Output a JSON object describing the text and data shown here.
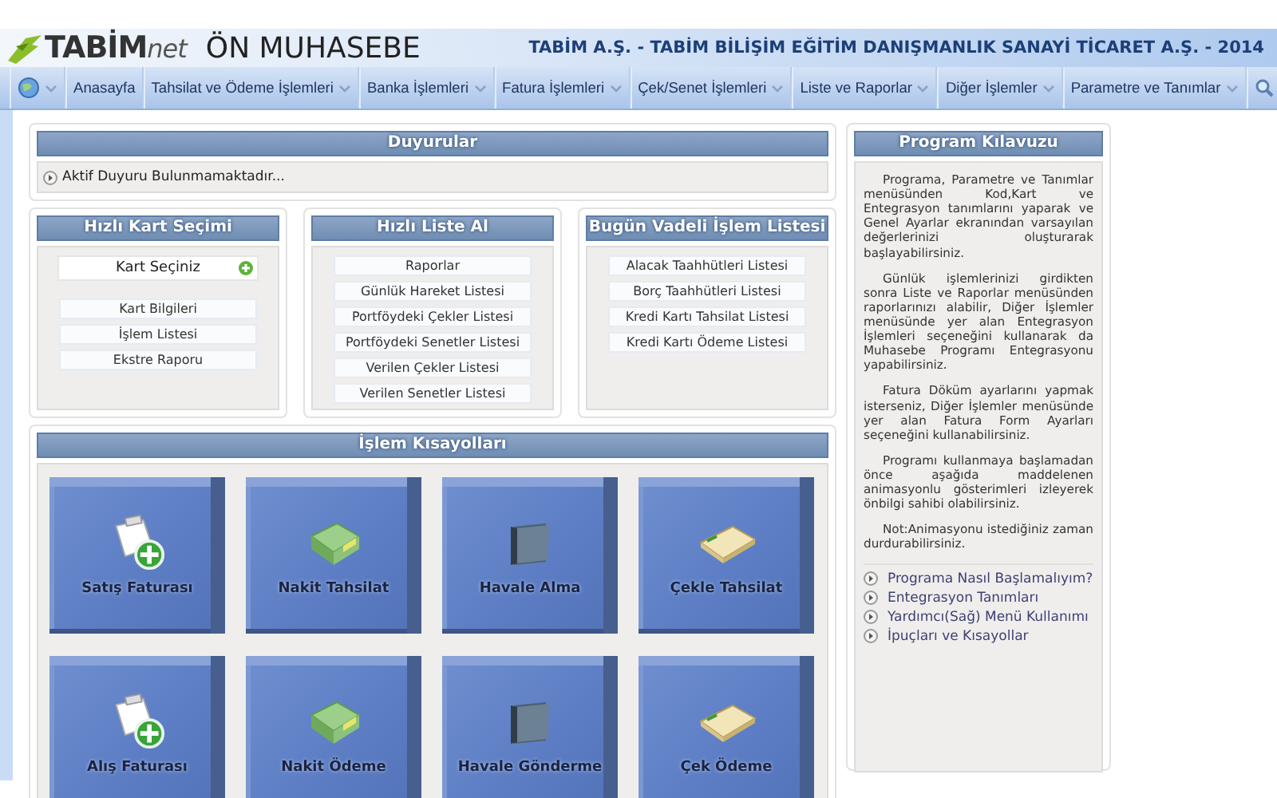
{
  "header": {
    "logo_brand": "TABİM",
    "logo_suffix": "net",
    "app_title": "ÖN MUHASEBE",
    "company": "TABİM A.Ş. - TABİM BİLİŞİM EĞİTİM DANIŞMANLIK SANAYİ TİCARET A.Ş. - 2014"
  },
  "menu": [
    {
      "kind": "globe",
      "dropdown": true
    },
    {
      "kind": "text",
      "label": "Anasayfa",
      "dropdown": false
    },
    {
      "kind": "text",
      "label": "Tahsilat ve Ödeme İşlemleri",
      "dropdown": true
    },
    {
      "kind": "text",
      "label": "Banka İşlemleri",
      "dropdown": true
    },
    {
      "kind": "text",
      "label": "Fatura İşlemleri",
      "dropdown": true
    },
    {
      "kind": "text",
      "label": "Çek/Senet İşlemleri",
      "dropdown": true
    },
    {
      "kind": "text",
      "label": "Liste ve Raporlar",
      "dropdown": true
    },
    {
      "kind": "text",
      "label": "Diğer İşlemler",
      "dropdown": true
    },
    {
      "kind": "text",
      "label": "Parametre ve Tanımlar",
      "dropdown": true
    },
    {
      "kind": "search",
      "dropdown": false
    }
  ],
  "announcements": {
    "title": "Duyurular",
    "text": "Aktif Duyuru Bulunmamaktadır..."
  },
  "quick_panels": [
    {
      "title": "Hızlı Kart Seçimi",
      "picker": {
        "label": "Kart Seçiniz"
      },
      "items": [
        "Kart Bilgileri",
        "İşlem Listesi",
        "Ekstre Raporu"
      ]
    },
    {
      "title": "Hızlı Liste Al",
      "items": [
        "Raporlar",
        "Günlük Hareket Listesi",
        "Portföydeki Çekler Listesi",
        "Portföydeki Senetler Listesi",
        "Verilen Çekler Listesi",
        "Verilen Senetler Listesi"
      ]
    },
    {
      "title": "Bugün Vadeli İşlem Listesi",
      "items": [
        "Alacak Taahhütleri Listesi",
        "Borç Taahhütleri Listesi",
        "Kredi Kartı Tahsilat Listesi",
        "Kredi Kartı Ödeme Listesi"
      ]
    }
  ],
  "shortcuts": {
    "title": "İşlem Kısayolları",
    "tiles": [
      {
        "label": "Satış Faturası",
        "kind": "invoice"
      },
      {
        "label": "Nakit Tahsilat",
        "kind": "cash"
      },
      {
        "label": "Havale Alma",
        "kind": "folder"
      },
      {
        "label": "Çekle Tahsilat",
        "kind": "cheque"
      },
      {
        "label": "Alış Faturası",
        "kind": "invoice"
      },
      {
        "label": "Nakit Ödeme",
        "kind": "cash"
      },
      {
        "label": "Havale Gönderme",
        "kind": "folder"
      },
      {
        "label": "Çek Ödeme",
        "kind": "cheque"
      }
    ]
  },
  "guide": {
    "title": "Program Kılavuzu",
    "paragraphs": [
      "Programa, Parametre ve Tanımlar menüsünden Kod,Kart ve Entegrasyon tanımlarını yaparak ve Genel Ayarlar ekranından varsayılan değerlerinizi oluşturarak başlayabilirsiniz.",
      "Günlük işlemlerinizi girdikten sonra Liste ve Raporlar menüsünden raporlarınızı alabilir, Diğer İşlemler menüsünde yer alan Entegrasyon İşlemleri seçeneğini kullanarak da Muhasebe Programı Entegrasyonu yapabilirsiniz.",
      "Fatura Döküm ayarlarını yapmak isterseniz, Diğer İşlemler menüsünde yer alan Fatura Form Ayarları seçeneğini kullanabilirsiniz.",
      "Programı kullanmaya başlamadan önce aşağıda maddelenen animasyonlu gösterimleri izleyerek önbilgi sahibi olabilirsiniz.",
      "Not:Animasyonu istediğiniz zaman durdurabilirsiniz."
    ],
    "links": [
      "Programa Nasıl Başlamalıyım?",
      "Entegrasyon Tanımları",
      "Yardımcı(Sağ) Menü Kullanımı",
      "İpuçları ve Kısayollar"
    ]
  }
}
